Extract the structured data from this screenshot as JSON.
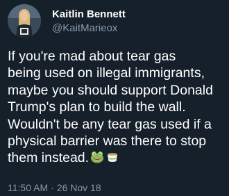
{
  "tweet": {
    "author": {
      "display_name": "Kaitlin Bennett",
      "handle": "@KaitMarieox"
    },
    "body_lines": [
      "If you're mad about tear gas",
      "being used on illegal immigrants,",
      "maybe you should support Donald",
      "Trump's plan to build the wall.",
      "Wouldn't be any tear gas used if a",
      "physical barrier was there to stop",
      "them instead."
    ],
    "emojis": [
      "frog-face-icon",
      "tea-cup-icon"
    ],
    "time": "11:50 AM",
    "separator": "·",
    "date": "26 Nov 18"
  },
  "colors": {
    "background": "#15202b",
    "primary_text": "#ffffff",
    "secondary_text": "#8899a6"
  }
}
